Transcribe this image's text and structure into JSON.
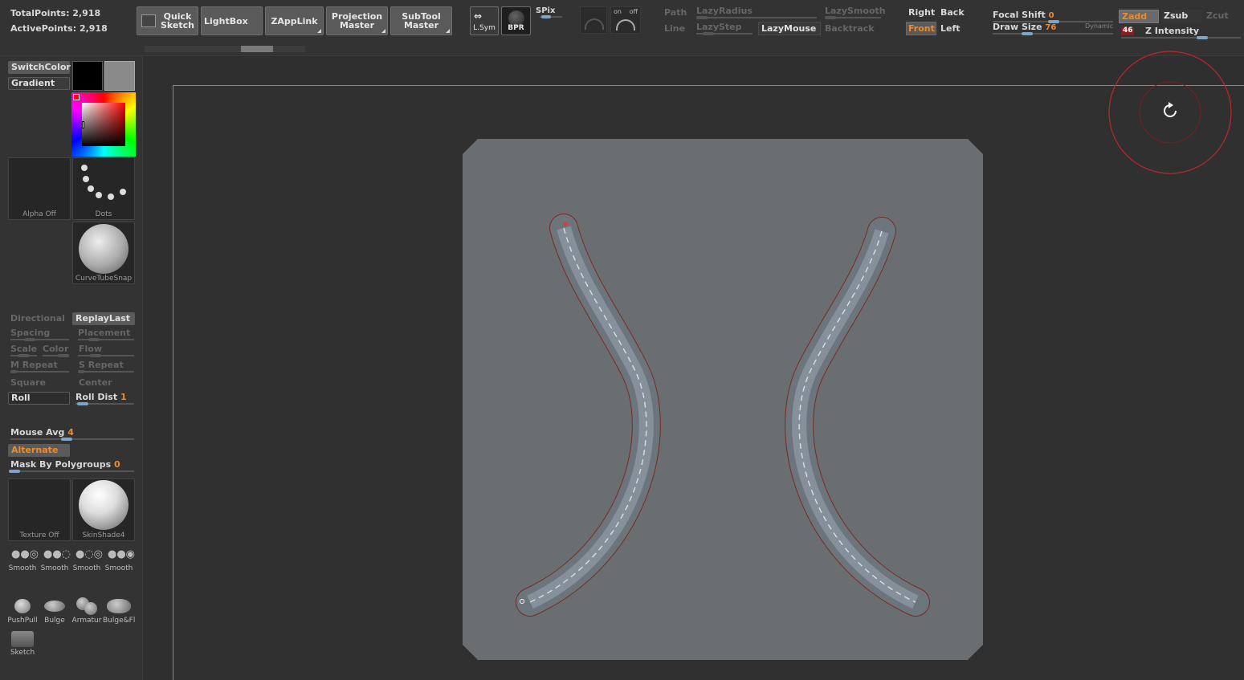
{
  "stats": {
    "total_points": "TotalPoints: 2,918",
    "active_points": "ActivePoints: 2,918"
  },
  "toolbar": {
    "quick_sketch": "Quick\nSketch",
    "lightbox": "LightBox",
    "zapplink": "ZAppLink",
    "projection_master": "Projection\nMaster",
    "subtool_master": "SubTool\nMaster",
    "lsym": "L.Sym",
    "bpr": "BPR",
    "spix": "SPix",
    "on": "on",
    "off": "off"
  },
  "stroke_controls": {
    "path": "Path",
    "line": "Line",
    "lazy_radius": "LazyRadius",
    "lazy_step": "LazyStep",
    "lazy_mouse": "LazyMouse",
    "lazy_smooth": "LazySmooth",
    "backtrack": "Backtrack"
  },
  "views": {
    "right": "Right",
    "back": "Back",
    "front": "Front",
    "left": "Left"
  },
  "brush_settings": {
    "focal_shift_label": "Focal Shift",
    "focal_shift_value": "0",
    "draw_size_label": "Draw Size",
    "draw_size_value": "76",
    "dynamic": "Dynamic",
    "zadd": "Zadd",
    "zsub": "Zsub",
    "zcut": "Zcut",
    "z_intensity_value": "46",
    "z_intensity_label": "Z Intensity"
  },
  "left_panel": {
    "switch_color": "SwitchColor",
    "gradient": "Gradient",
    "alpha_off": "Alpha Off",
    "dots": "Dots",
    "brush_name": "CurveTubeSnap",
    "directional": "Directional",
    "replay_last": "ReplayLast",
    "spacing": "Spacing",
    "placement": "Placement",
    "scale": "Scale",
    "color": "Color",
    "flow": "Flow",
    "m_repeat": "M Repeat",
    "s_repeat": "S Repeat",
    "square": "Square",
    "center": "Center",
    "roll": "Roll",
    "roll_dist_label": "Roll Dist",
    "roll_dist_value": "1",
    "mouse_avg_label": "Mouse Avg",
    "mouse_avg_value": "4",
    "alternate": "Alternate",
    "mask_by_polygroups_label": "Mask By Polygroups",
    "mask_by_polygroups_value": "0",
    "texture_off": "Texture Off",
    "material": "SkinShade4",
    "smooth_brushes": [
      "Smooth",
      "Smooth",
      "Smooth",
      "Smooth"
    ],
    "brushes": [
      "PushPull",
      "Bulge",
      "Armatur",
      "Bulge&Fl"
    ],
    "sketch": "Sketch"
  },
  "colors": {
    "accent_orange": "#f08a2a",
    "ui_background": "#2f2f2f",
    "canvas_plane": "#6b6e71",
    "brush_ring": "#c0262a"
  },
  "icons": {
    "rotate_cursor": "rotate-icon"
  }
}
